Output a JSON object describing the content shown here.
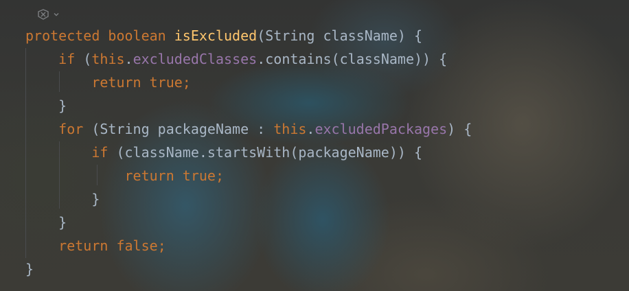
{
  "editor": {
    "language": "java",
    "inlay_icon": "code-vision-icon",
    "colors": {
      "keyword": "#cc7832",
      "method_decl": "#ffc66d",
      "field": "#9876aa",
      "text": "#a9b7c6"
    },
    "lines": [
      {
        "indent": 0,
        "tokens": [
          {
            "t": "protected",
            "c": "kw"
          },
          {
            "t": " ",
            "c": "plain"
          },
          {
            "t": "boolean",
            "c": "kw"
          },
          {
            "t": " ",
            "c": "plain"
          },
          {
            "t": "isExcluded",
            "c": "fn"
          },
          {
            "t": "(String className) {",
            "c": "plain"
          }
        ]
      },
      {
        "indent": 1,
        "tokens": [
          {
            "t": "if",
            "c": "kw"
          },
          {
            "t": " (",
            "c": "plain"
          },
          {
            "t": "this",
            "c": "kw"
          },
          {
            "t": ".",
            "c": "plain"
          },
          {
            "t": "excludedClasses",
            "c": "fld"
          },
          {
            "t": ".contains(className)) {",
            "c": "plain"
          }
        ]
      },
      {
        "indent": 2,
        "tokens": [
          {
            "t": "return",
            "c": "kw"
          },
          {
            "t": " ",
            "c": "plain"
          },
          {
            "t": "true",
            "c": "kw"
          },
          {
            "t": ";",
            "c": "kw"
          }
        ]
      },
      {
        "indent": 1,
        "tokens": [
          {
            "t": "}",
            "c": "plain"
          }
        ]
      },
      {
        "indent": 1,
        "tokens": [
          {
            "t": "for",
            "c": "kw"
          },
          {
            "t": " (String packageName : ",
            "c": "plain"
          },
          {
            "t": "this",
            "c": "kw"
          },
          {
            "t": ".",
            "c": "plain"
          },
          {
            "t": "excludedPackages",
            "c": "fld"
          },
          {
            "t": ") {",
            "c": "plain"
          }
        ]
      },
      {
        "indent": 2,
        "tokens": [
          {
            "t": "if",
            "c": "kw"
          },
          {
            "t": " (className.startsWith(packageName)) {",
            "c": "plain"
          }
        ]
      },
      {
        "indent": 3,
        "tokens": [
          {
            "t": "return",
            "c": "kw"
          },
          {
            "t": " ",
            "c": "plain"
          },
          {
            "t": "true",
            "c": "kw"
          },
          {
            "t": ";",
            "c": "kw"
          }
        ]
      },
      {
        "indent": 2,
        "tokens": [
          {
            "t": "}",
            "c": "plain"
          }
        ]
      },
      {
        "indent": 1,
        "tokens": [
          {
            "t": "}",
            "c": "plain"
          }
        ]
      },
      {
        "indent": 1,
        "tokens": [
          {
            "t": "return",
            "c": "kw"
          },
          {
            "t": " ",
            "c": "plain"
          },
          {
            "t": "false",
            "c": "kw"
          },
          {
            "t": ";",
            "c": "kw"
          }
        ]
      },
      {
        "indent": 0,
        "tokens": [
          {
            "t": "}",
            "c": "plain"
          }
        ]
      }
    ]
  }
}
